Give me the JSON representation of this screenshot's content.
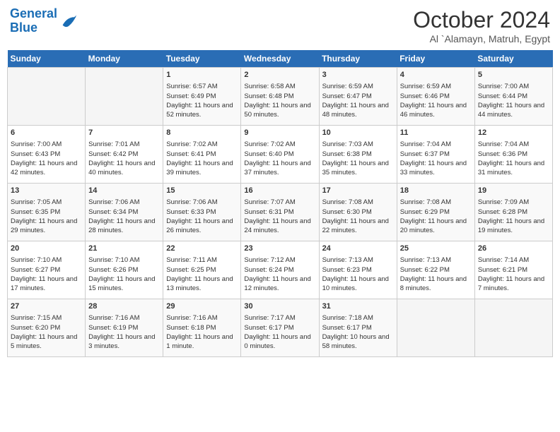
{
  "header": {
    "logo_line1": "General",
    "logo_line2": "Blue",
    "month": "October 2024",
    "location": "Al `Alamayn, Matruh, Egypt"
  },
  "weekdays": [
    "Sunday",
    "Monday",
    "Tuesday",
    "Wednesday",
    "Thursday",
    "Friday",
    "Saturday"
  ],
  "weeks": [
    [
      {
        "day": "",
        "sunrise": "",
        "sunset": "",
        "daylight": ""
      },
      {
        "day": "",
        "sunrise": "",
        "sunset": "",
        "daylight": ""
      },
      {
        "day": "1",
        "sunrise": "Sunrise: 6:57 AM",
        "sunset": "Sunset: 6:49 PM",
        "daylight": "Daylight: 11 hours and 52 minutes."
      },
      {
        "day": "2",
        "sunrise": "Sunrise: 6:58 AM",
        "sunset": "Sunset: 6:48 PM",
        "daylight": "Daylight: 11 hours and 50 minutes."
      },
      {
        "day": "3",
        "sunrise": "Sunrise: 6:59 AM",
        "sunset": "Sunset: 6:47 PM",
        "daylight": "Daylight: 11 hours and 48 minutes."
      },
      {
        "day": "4",
        "sunrise": "Sunrise: 6:59 AM",
        "sunset": "Sunset: 6:46 PM",
        "daylight": "Daylight: 11 hours and 46 minutes."
      },
      {
        "day": "5",
        "sunrise": "Sunrise: 7:00 AM",
        "sunset": "Sunset: 6:44 PM",
        "daylight": "Daylight: 11 hours and 44 minutes."
      }
    ],
    [
      {
        "day": "6",
        "sunrise": "Sunrise: 7:00 AM",
        "sunset": "Sunset: 6:43 PM",
        "daylight": "Daylight: 11 hours and 42 minutes."
      },
      {
        "day": "7",
        "sunrise": "Sunrise: 7:01 AM",
        "sunset": "Sunset: 6:42 PM",
        "daylight": "Daylight: 11 hours and 40 minutes."
      },
      {
        "day": "8",
        "sunrise": "Sunrise: 7:02 AM",
        "sunset": "Sunset: 6:41 PM",
        "daylight": "Daylight: 11 hours and 39 minutes."
      },
      {
        "day": "9",
        "sunrise": "Sunrise: 7:02 AM",
        "sunset": "Sunset: 6:40 PM",
        "daylight": "Daylight: 11 hours and 37 minutes."
      },
      {
        "day": "10",
        "sunrise": "Sunrise: 7:03 AM",
        "sunset": "Sunset: 6:38 PM",
        "daylight": "Daylight: 11 hours and 35 minutes."
      },
      {
        "day": "11",
        "sunrise": "Sunrise: 7:04 AM",
        "sunset": "Sunset: 6:37 PM",
        "daylight": "Daylight: 11 hours and 33 minutes."
      },
      {
        "day": "12",
        "sunrise": "Sunrise: 7:04 AM",
        "sunset": "Sunset: 6:36 PM",
        "daylight": "Daylight: 11 hours and 31 minutes."
      }
    ],
    [
      {
        "day": "13",
        "sunrise": "Sunrise: 7:05 AM",
        "sunset": "Sunset: 6:35 PM",
        "daylight": "Daylight: 11 hours and 29 minutes."
      },
      {
        "day": "14",
        "sunrise": "Sunrise: 7:06 AM",
        "sunset": "Sunset: 6:34 PM",
        "daylight": "Daylight: 11 hours and 28 minutes."
      },
      {
        "day": "15",
        "sunrise": "Sunrise: 7:06 AM",
        "sunset": "Sunset: 6:33 PM",
        "daylight": "Daylight: 11 hours and 26 minutes."
      },
      {
        "day": "16",
        "sunrise": "Sunrise: 7:07 AM",
        "sunset": "Sunset: 6:31 PM",
        "daylight": "Daylight: 11 hours and 24 minutes."
      },
      {
        "day": "17",
        "sunrise": "Sunrise: 7:08 AM",
        "sunset": "Sunset: 6:30 PM",
        "daylight": "Daylight: 11 hours and 22 minutes."
      },
      {
        "day": "18",
        "sunrise": "Sunrise: 7:08 AM",
        "sunset": "Sunset: 6:29 PM",
        "daylight": "Daylight: 11 hours and 20 minutes."
      },
      {
        "day": "19",
        "sunrise": "Sunrise: 7:09 AM",
        "sunset": "Sunset: 6:28 PM",
        "daylight": "Daylight: 11 hours and 19 minutes."
      }
    ],
    [
      {
        "day": "20",
        "sunrise": "Sunrise: 7:10 AM",
        "sunset": "Sunset: 6:27 PM",
        "daylight": "Daylight: 11 hours and 17 minutes."
      },
      {
        "day": "21",
        "sunrise": "Sunrise: 7:10 AM",
        "sunset": "Sunset: 6:26 PM",
        "daylight": "Daylight: 11 hours and 15 minutes."
      },
      {
        "day": "22",
        "sunrise": "Sunrise: 7:11 AM",
        "sunset": "Sunset: 6:25 PM",
        "daylight": "Daylight: 11 hours and 13 minutes."
      },
      {
        "day": "23",
        "sunrise": "Sunrise: 7:12 AM",
        "sunset": "Sunset: 6:24 PM",
        "daylight": "Daylight: 11 hours and 12 minutes."
      },
      {
        "day": "24",
        "sunrise": "Sunrise: 7:13 AM",
        "sunset": "Sunset: 6:23 PM",
        "daylight": "Daylight: 11 hours and 10 minutes."
      },
      {
        "day": "25",
        "sunrise": "Sunrise: 7:13 AM",
        "sunset": "Sunset: 6:22 PM",
        "daylight": "Daylight: 11 hours and 8 minutes."
      },
      {
        "day": "26",
        "sunrise": "Sunrise: 7:14 AM",
        "sunset": "Sunset: 6:21 PM",
        "daylight": "Daylight: 11 hours and 7 minutes."
      }
    ],
    [
      {
        "day": "27",
        "sunrise": "Sunrise: 7:15 AM",
        "sunset": "Sunset: 6:20 PM",
        "daylight": "Daylight: 11 hours and 5 minutes."
      },
      {
        "day": "28",
        "sunrise": "Sunrise: 7:16 AM",
        "sunset": "Sunset: 6:19 PM",
        "daylight": "Daylight: 11 hours and 3 minutes."
      },
      {
        "day": "29",
        "sunrise": "Sunrise: 7:16 AM",
        "sunset": "Sunset: 6:18 PM",
        "daylight": "Daylight: 11 hours and 1 minute."
      },
      {
        "day": "30",
        "sunrise": "Sunrise: 7:17 AM",
        "sunset": "Sunset: 6:17 PM",
        "daylight": "Daylight: 11 hours and 0 minutes."
      },
      {
        "day": "31",
        "sunrise": "Sunrise: 7:18 AM",
        "sunset": "Sunset: 6:17 PM",
        "daylight": "Daylight: 10 hours and 58 minutes."
      },
      {
        "day": "",
        "sunrise": "",
        "sunset": "",
        "daylight": ""
      },
      {
        "day": "",
        "sunrise": "",
        "sunset": "",
        "daylight": ""
      }
    ]
  ]
}
